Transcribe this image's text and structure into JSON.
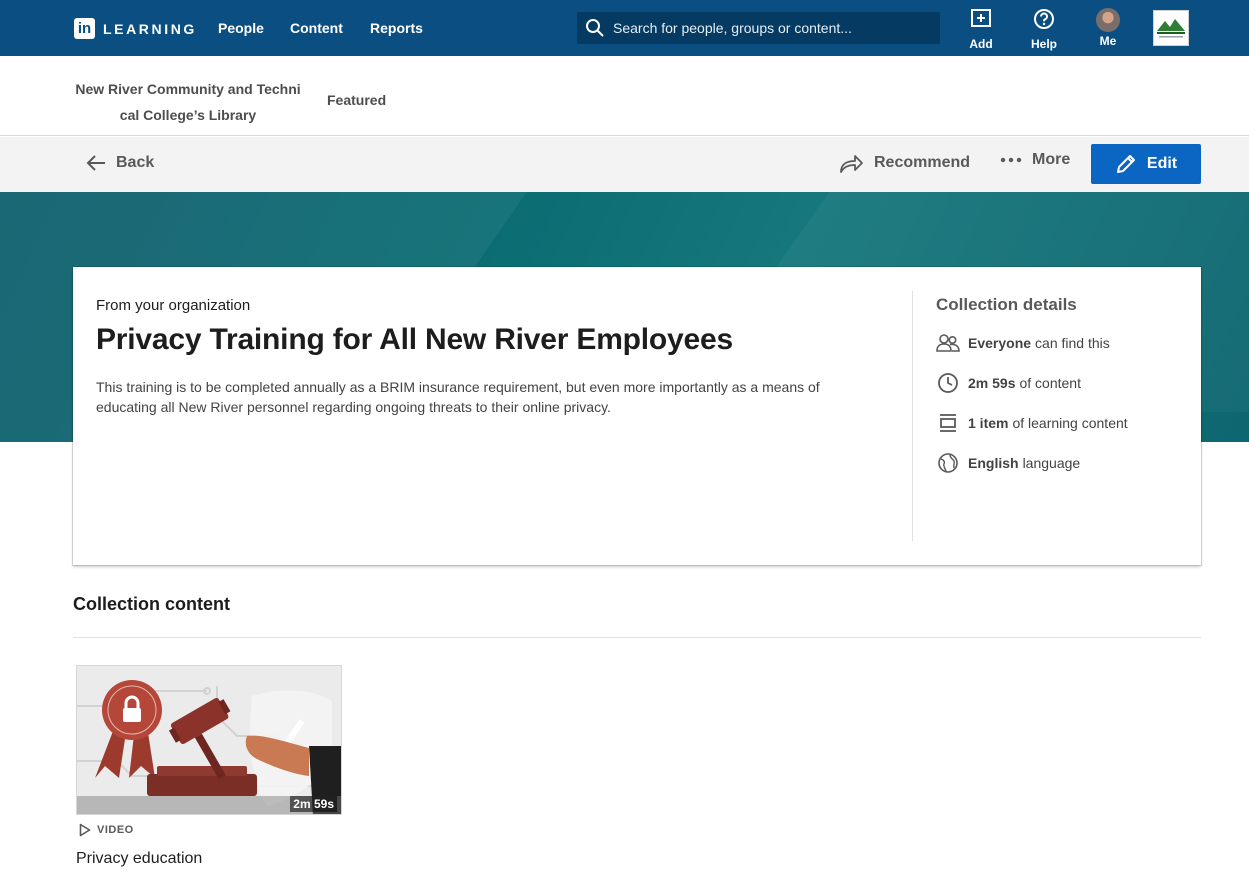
{
  "brand": {
    "logo_text": "LEARNING",
    "logo_mark": "in"
  },
  "nav": {
    "links": [
      "People",
      "Content",
      "Reports"
    ],
    "search_placeholder": "Search for people, groups or content...",
    "add_label": "Add",
    "help_label": "Help",
    "me_label": "Me"
  },
  "tabs": {
    "library_line1": "New River Community and Techni",
    "library_line2": "cal College’s Library",
    "featured": "Featured"
  },
  "actions": {
    "back": "Back",
    "recommend": "Recommend",
    "more": "More",
    "edit": "Edit"
  },
  "collection": {
    "source": "From your organization",
    "title": "Privacy Training for All New River Employees",
    "description": "This training is to be completed annually as a BRIM insurance requirement, but even more importantly as a means of educating all New River personnel regarding ongoing threats to their online privacy."
  },
  "details": {
    "title": "Collection details",
    "visibility_strong": "Everyone",
    "visibility_rest": "can find this",
    "duration_strong": "2m 59s",
    "duration_rest": "of content",
    "items_strong": "1 item",
    "items_rest": "of learning content",
    "language_strong": "English",
    "language_rest": "language"
  },
  "content": {
    "section_title": "Collection content",
    "items": [
      {
        "type": "VIDEO",
        "title": "Privacy education",
        "duration": "2m 59s"
      }
    ]
  },
  "colors": {
    "nav": "#0b4f82",
    "primary": "#0a66c2",
    "hero": "#0b6e73"
  }
}
